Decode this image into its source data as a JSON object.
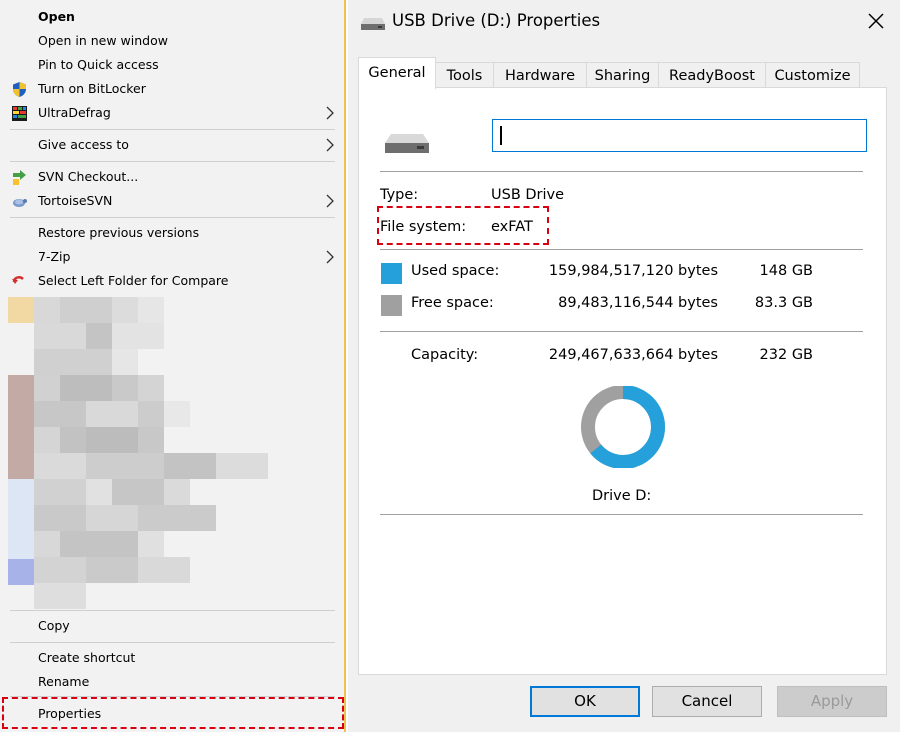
{
  "context_menu": {
    "items": [
      {
        "label": "Open"
      },
      {
        "label": "Open in new window"
      },
      {
        "label": "Pin to Quick access"
      },
      {
        "label": "Turn on BitLocker"
      },
      {
        "label": "UltraDefrag"
      },
      {
        "label": "Give access to"
      },
      {
        "label": "SVN Checkout..."
      },
      {
        "label": "TortoiseSVN"
      },
      {
        "label": "Restore previous versions"
      },
      {
        "label": "7-Zip"
      },
      {
        "label": "Select Left Folder for Compare"
      },
      {
        "label": "Copy"
      },
      {
        "label": "Create shortcut"
      },
      {
        "label": "Rename"
      },
      {
        "label": "Properties"
      }
    ],
    "icons": {
      "bitlocker": "shield-icon",
      "ultradefrag": "defrag-icon",
      "svn_checkout": "svn-checkout-icon",
      "tortoisesvn": "tortoise-icon",
      "compare": "compare-arrow-icon"
    },
    "highlight_color": "#d9000f"
  },
  "dialog": {
    "title": "USB Drive (D:) Properties",
    "tabs": [
      "General",
      "Tools",
      "Hardware",
      "Sharing",
      "ReadyBoost",
      "Customize"
    ],
    "active_tab": "General",
    "name_input_value": "",
    "type_label": "Type:",
    "type_value": "USB Drive",
    "fs_label": "File system:",
    "fs_value": "exFAT",
    "used_label": "Used space:",
    "used_bytes": "159,984,517,120 bytes",
    "used_gb": "148 GB",
    "free_label": "Free space:",
    "free_bytes": "89,483,116,544 bytes",
    "free_gb": "83.3 GB",
    "capacity_label": "Capacity:",
    "capacity_bytes": "249,467,633,664 bytes",
    "capacity_gb": "232 GB",
    "drive_label": "Drive D:",
    "buttons": {
      "ok": "OK",
      "cancel": "Cancel",
      "apply": "Apply"
    },
    "used_fraction": 0.641,
    "used_color": "#26a0da",
    "free_color": "#a0a0a0"
  }
}
